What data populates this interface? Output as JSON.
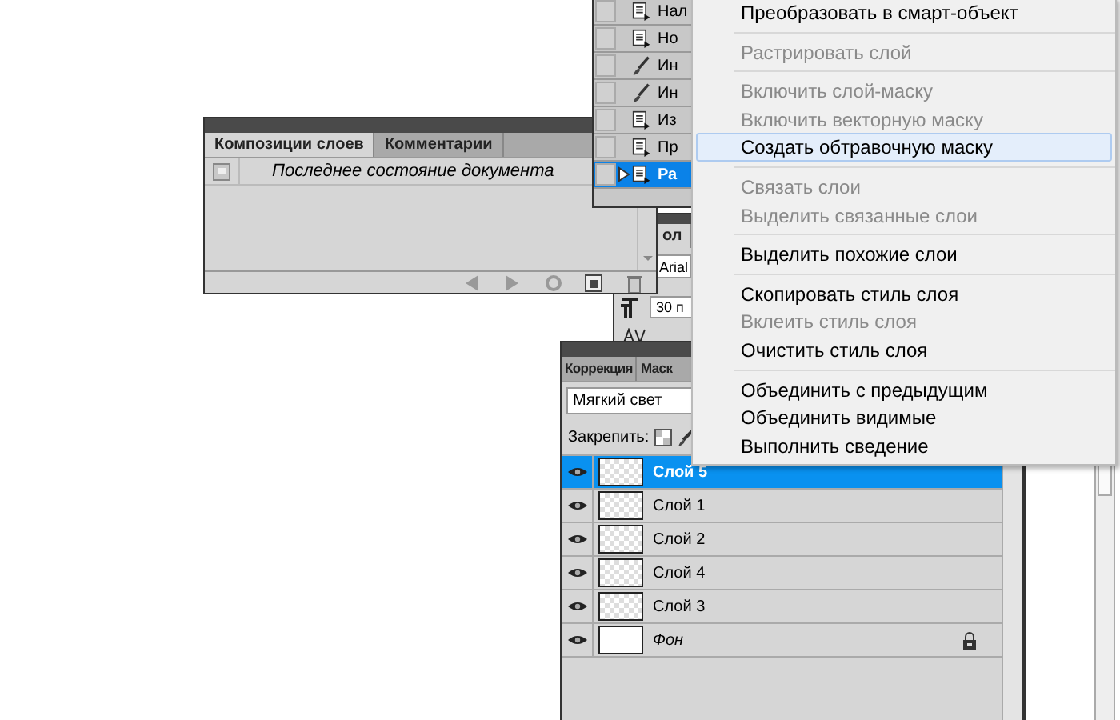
{
  "actions_panel": {
    "rows": [
      {
        "label": "Нал",
        "kind": "set",
        "selected": false
      },
      {
        "label": "Но",
        "kind": "set",
        "selected": false
      },
      {
        "label": "Ин",
        "kind": "brush",
        "selected": false
      },
      {
        "label": "Ин",
        "kind": "brush",
        "selected": false
      },
      {
        "label": "Из",
        "kind": "set",
        "selected": false
      },
      {
        "label": "Пр",
        "kind": "set",
        "selected": false
      },
      {
        "label": "Ра",
        "kind": "set",
        "selected": true
      }
    ]
  },
  "layer_comps_panel": {
    "tabs": [
      {
        "label": "Композиции слоев",
        "selected": true
      },
      {
        "label": "Комментарии",
        "selected": false
      }
    ],
    "items": [
      {
        "label": "Последнее состояние документа"
      }
    ]
  },
  "character_panel": {
    "tab": "ол",
    "font": "Arial",
    "size": "30 п"
  },
  "layers_panel": {
    "tabs": [
      {
        "label": "Коррекция",
        "selected": false
      },
      {
        "label": "Маск",
        "selected": false
      }
    ],
    "blend_mode": "Мягкий свет",
    "lock_label": "Закрепить:",
    "layers": [
      {
        "name": "Слой 5",
        "kind": "layer",
        "visible": true,
        "selected": true,
        "locked": false
      },
      {
        "name": "Слой 1",
        "kind": "layer",
        "visible": true,
        "selected": false,
        "locked": false
      },
      {
        "name": "Слой 2",
        "kind": "layer",
        "visible": true,
        "selected": false,
        "locked": false
      },
      {
        "name": "Слой 4",
        "kind": "layer",
        "visible": true,
        "selected": false,
        "locked": false
      },
      {
        "name": "Слой 3",
        "kind": "layer",
        "visible": true,
        "selected": false,
        "locked": false
      },
      {
        "name": "Фон",
        "kind": "background",
        "visible": true,
        "selected": false,
        "locked": true
      }
    ]
  },
  "context_menu": {
    "items": [
      {
        "kind": "item",
        "label": "Преобразовать в смарт-объект",
        "disabled": false,
        "highlighted": false
      },
      {
        "kind": "separator"
      },
      {
        "kind": "item",
        "label": "Растрировать слой",
        "disabled": true,
        "highlighted": false
      },
      {
        "kind": "separator"
      },
      {
        "kind": "item",
        "label": "Включить слой-маску",
        "disabled": true,
        "highlighted": false
      },
      {
        "kind": "item",
        "label": "Включить векторную маску",
        "disabled": true,
        "highlighted": false
      },
      {
        "kind": "item",
        "label": "Создать обтравочную маску",
        "disabled": false,
        "highlighted": true
      },
      {
        "kind": "separator"
      },
      {
        "kind": "item",
        "label": "Связать слои",
        "disabled": true,
        "highlighted": false
      },
      {
        "kind": "item",
        "label": "Выделить связанные слои",
        "disabled": true,
        "highlighted": false
      },
      {
        "kind": "separator"
      },
      {
        "kind": "item",
        "label": "Выделить похожие слои",
        "disabled": false,
        "highlighted": false
      },
      {
        "kind": "separator"
      },
      {
        "kind": "item",
        "label": "Скопировать стиль слоя",
        "disabled": false,
        "highlighted": false
      },
      {
        "kind": "item",
        "label": "Вклеить стиль слоя",
        "disabled": true,
        "highlighted": false
      },
      {
        "kind": "item",
        "label": "Очистить стиль слоя",
        "disabled": false,
        "highlighted": false
      },
      {
        "kind": "separator"
      },
      {
        "kind": "item",
        "label": "Объединить с предыдущим",
        "disabled": false,
        "highlighted": false
      },
      {
        "kind": "item",
        "label": "Объединить видимые",
        "disabled": false,
        "highlighted": false
      },
      {
        "kind": "item",
        "label": "Выполнить сведение",
        "disabled": false,
        "highlighted": false
      }
    ]
  }
}
